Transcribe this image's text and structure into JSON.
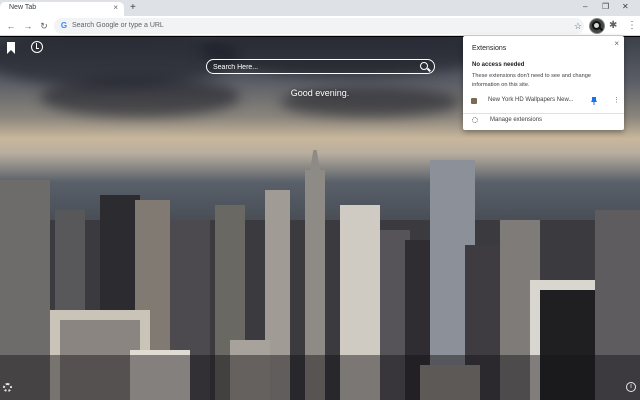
{
  "browser": {
    "tab_title": "New Tab",
    "tab_close": "×",
    "new_tab": "+",
    "window_minimize": "–",
    "window_maximize": "❐",
    "window_close": "✕",
    "back": "←",
    "forward": "→",
    "reload": "↻",
    "google_g": "G",
    "omnibox_placeholder": "Search Google or type a URL",
    "star": "☆",
    "puzzle": "✱",
    "menu": "⋮"
  },
  "newtab": {
    "search_placeholder": "Search Here...",
    "greeting": "Good evening.",
    "info": "i"
  },
  "extensions_popup": {
    "title": "Extensions",
    "close": "×",
    "section_heading": "No access needed",
    "section_description": "These extensions don't need to see and change information on this site.",
    "items": [
      {
        "name": "New York HD Wallpapers New...",
        "pinned": true,
        "menu": "⋮"
      }
    ],
    "manage_label": "Manage extensions"
  },
  "colors": {
    "tab_strip": "#dee1e6",
    "toolbar": "#ffffff",
    "pin_blue": "#1a73e8"
  }
}
